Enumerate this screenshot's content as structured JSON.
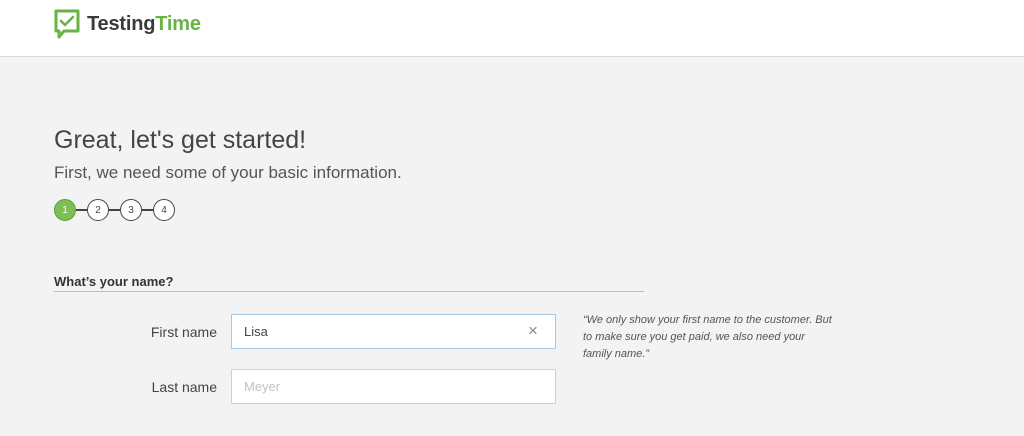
{
  "brand": {
    "name_part1": "Testing",
    "name_part2": "Time",
    "accent": "#69b244",
    "icon": "checkbox-chat-icon"
  },
  "page": {
    "title": "Great, let's get started!",
    "subtitle": "First, we need some of your basic information."
  },
  "stepper": {
    "steps": [
      "1",
      "2",
      "3",
      "4"
    ],
    "current": 1
  },
  "section": {
    "title": "What’s your name?"
  },
  "fields": {
    "first_name": {
      "label": "First name",
      "value": "Lisa",
      "clear_icon": "×"
    },
    "last_name": {
      "label": "Last name",
      "placeholder": "Meyer"
    }
  },
  "hint": "“We only show your first name to the customer. But to make sure you get paid, we also need your family name.”"
}
